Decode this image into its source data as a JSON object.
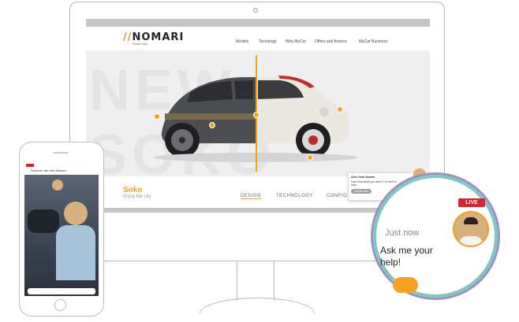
{
  "site": {
    "logo": "NOMARI",
    "logo_mark": "//",
    "logo_sub": "Smart cars",
    "nav": [
      "Models",
      "Tecnology",
      "Why MyCar",
      "Offers and finance",
      "MyCar Business"
    ],
    "hero_word": "NEW SOKO",
    "model_name": "Soko",
    "model_tagline": "Enjoy the city",
    "tabs": [
      "DESIGN",
      "TECHNOLOGY",
      "CONFIG"
    ]
  },
  "mini_chat": {
    "sender": "Alice from Nomari",
    "message": "Can't find what you need? I'm here to help.",
    "button": "Maybe later"
  },
  "phone": {
    "header": "Discover the new Nomari"
  },
  "live_widget": {
    "badge": "LIVE",
    "status": "Just now",
    "message": "Ask me your help!"
  },
  "colors": {
    "accent": "#f0a020",
    "live": "#d9232e",
    "ring": "#9b8fc7"
  }
}
